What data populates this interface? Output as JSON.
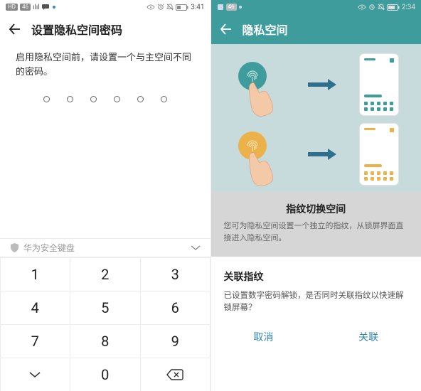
{
  "left": {
    "status": {
      "hd_label": "HD",
      "net_label": "46",
      "signal_label": "ılıl",
      "time": "3:41"
    },
    "title": "设置隐私空间密码",
    "message": "启用隐私空间前，请设置一个与主空间不同的密码。",
    "pin_length": 6,
    "keyboard_hint": "华为安全键盘",
    "keys": {
      "k1": "1",
      "k2": "2",
      "k3": "3",
      "k4": "4",
      "k5": "5",
      "k6": "6",
      "k7": "7",
      "k8": "8",
      "k9": "9",
      "k0": "0"
    }
  },
  "right": {
    "status": {
      "net_label": "46",
      "time": "2:34"
    },
    "title": "隐私空间",
    "info_title": "指纹切换空间",
    "info_body": "您可为隐私空间设置一个独立的指纹，从锁屏界面直接进入隐私空间。",
    "sheet_title": "关联指纹",
    "sheet_body": "已设置数字密码解锁，是否同时关联指纹以快速解锁屏幕？",
    "cancel": "取消",
    "confirm": "关联"
  }
}
